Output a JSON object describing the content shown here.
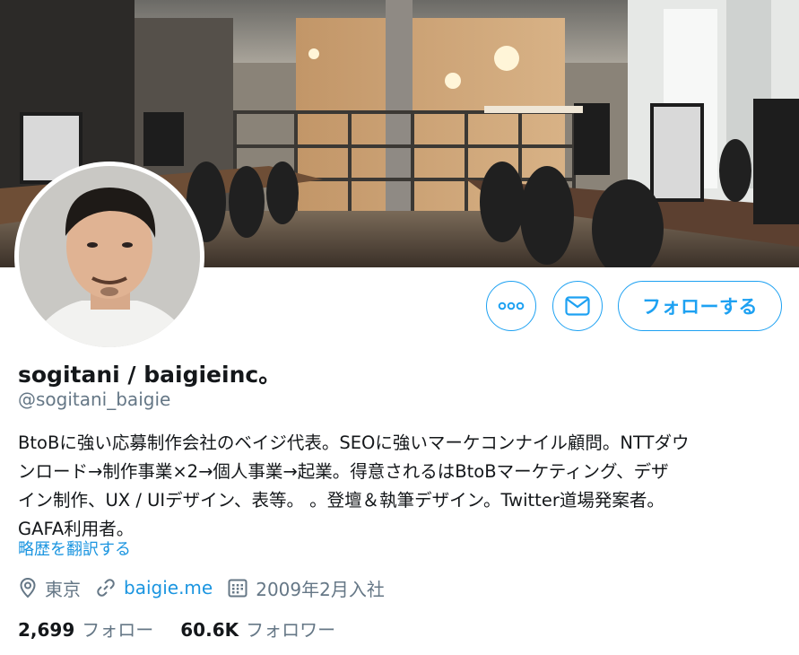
{
  "profile": {
    "display_name": "sogitani / baigieinc。",
    "handle": "@sogitani_baigie",
    "bio": "BtoBに強い応募制作会社のベイジ代表。SEOに強いマーケコンナイル顧問。NTTダウ\nンロード→制作事業×2→個人事業→起業。得意されるはBtoBマーケティング、デザ\nイン制作、UX / UIデザイン、表等。 。登壇＆執筆デザイン。Twitter道場発案者。\nGAFA利用者。",
    "translate_label": "略歴を翻訳する"
  },
  "actions": {
    "more_icon": "more-dots-icon",
    "message_icon": "envelope-icon",
    "follow_label": "フォローする"
  },
  "meta": {
    "location": "東京",
    "website": "baigie.me",
    "joined": "2009年2月入社"
  },
  "stats": {
    "following_count": "2,699",
    "following_label": "フォロー",
    "followers_count": "60.6K",
    "followers_label": "フォロワー"
  },
  "colors": {
    "accent": "#1da1f2",
    "link": "#1b95e0",
    "muted": "#657786",
    "text": "#14171a"
  }
}
